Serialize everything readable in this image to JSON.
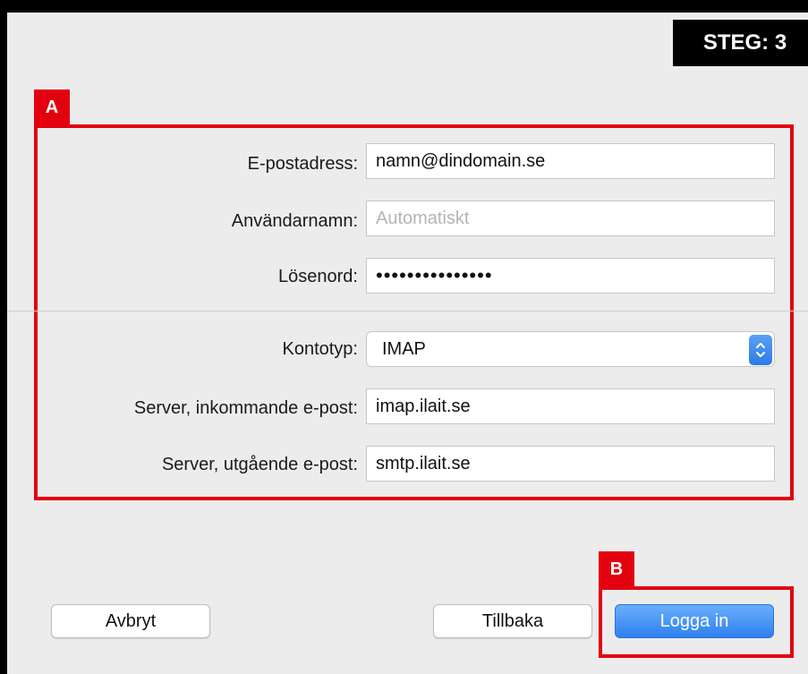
{
  "step": {
    "text": "STEG: 3"
  },
  "markers": {
    "a": "A",
    "b": "B"
  },
  "form": {
    "email": {
      "label": "E-postadress:",
      "value": "namn@dindomain.se"
    },
    "username": {
      "label": "Användarnamn:",
      "placeholder": "Automatiskt"
    },
    "password": {
      "label": "Lösenord:",
      "masked": "•••••••••••••••"
    },
    "account_type": {
      "label": "Kontotyp:",
      "value": "IMAP"
    },
    "incoming": {
      "label": "Server, inkommande e-post:",
      "value": "imap.ilait.se"
    },
    "outgoing": {
      "label": "Server, utgående e-post:",
      "value": "smtp.ilait.se"
    }
  },
  "buttons": {
    "cancel": "Avbryt",
    "back": "Tillbaka",
    "login": "Logga in"
  },
  "colors": {
    "highlight": "#e3000f",
    "primary": "#2f80ee"
  }
}
